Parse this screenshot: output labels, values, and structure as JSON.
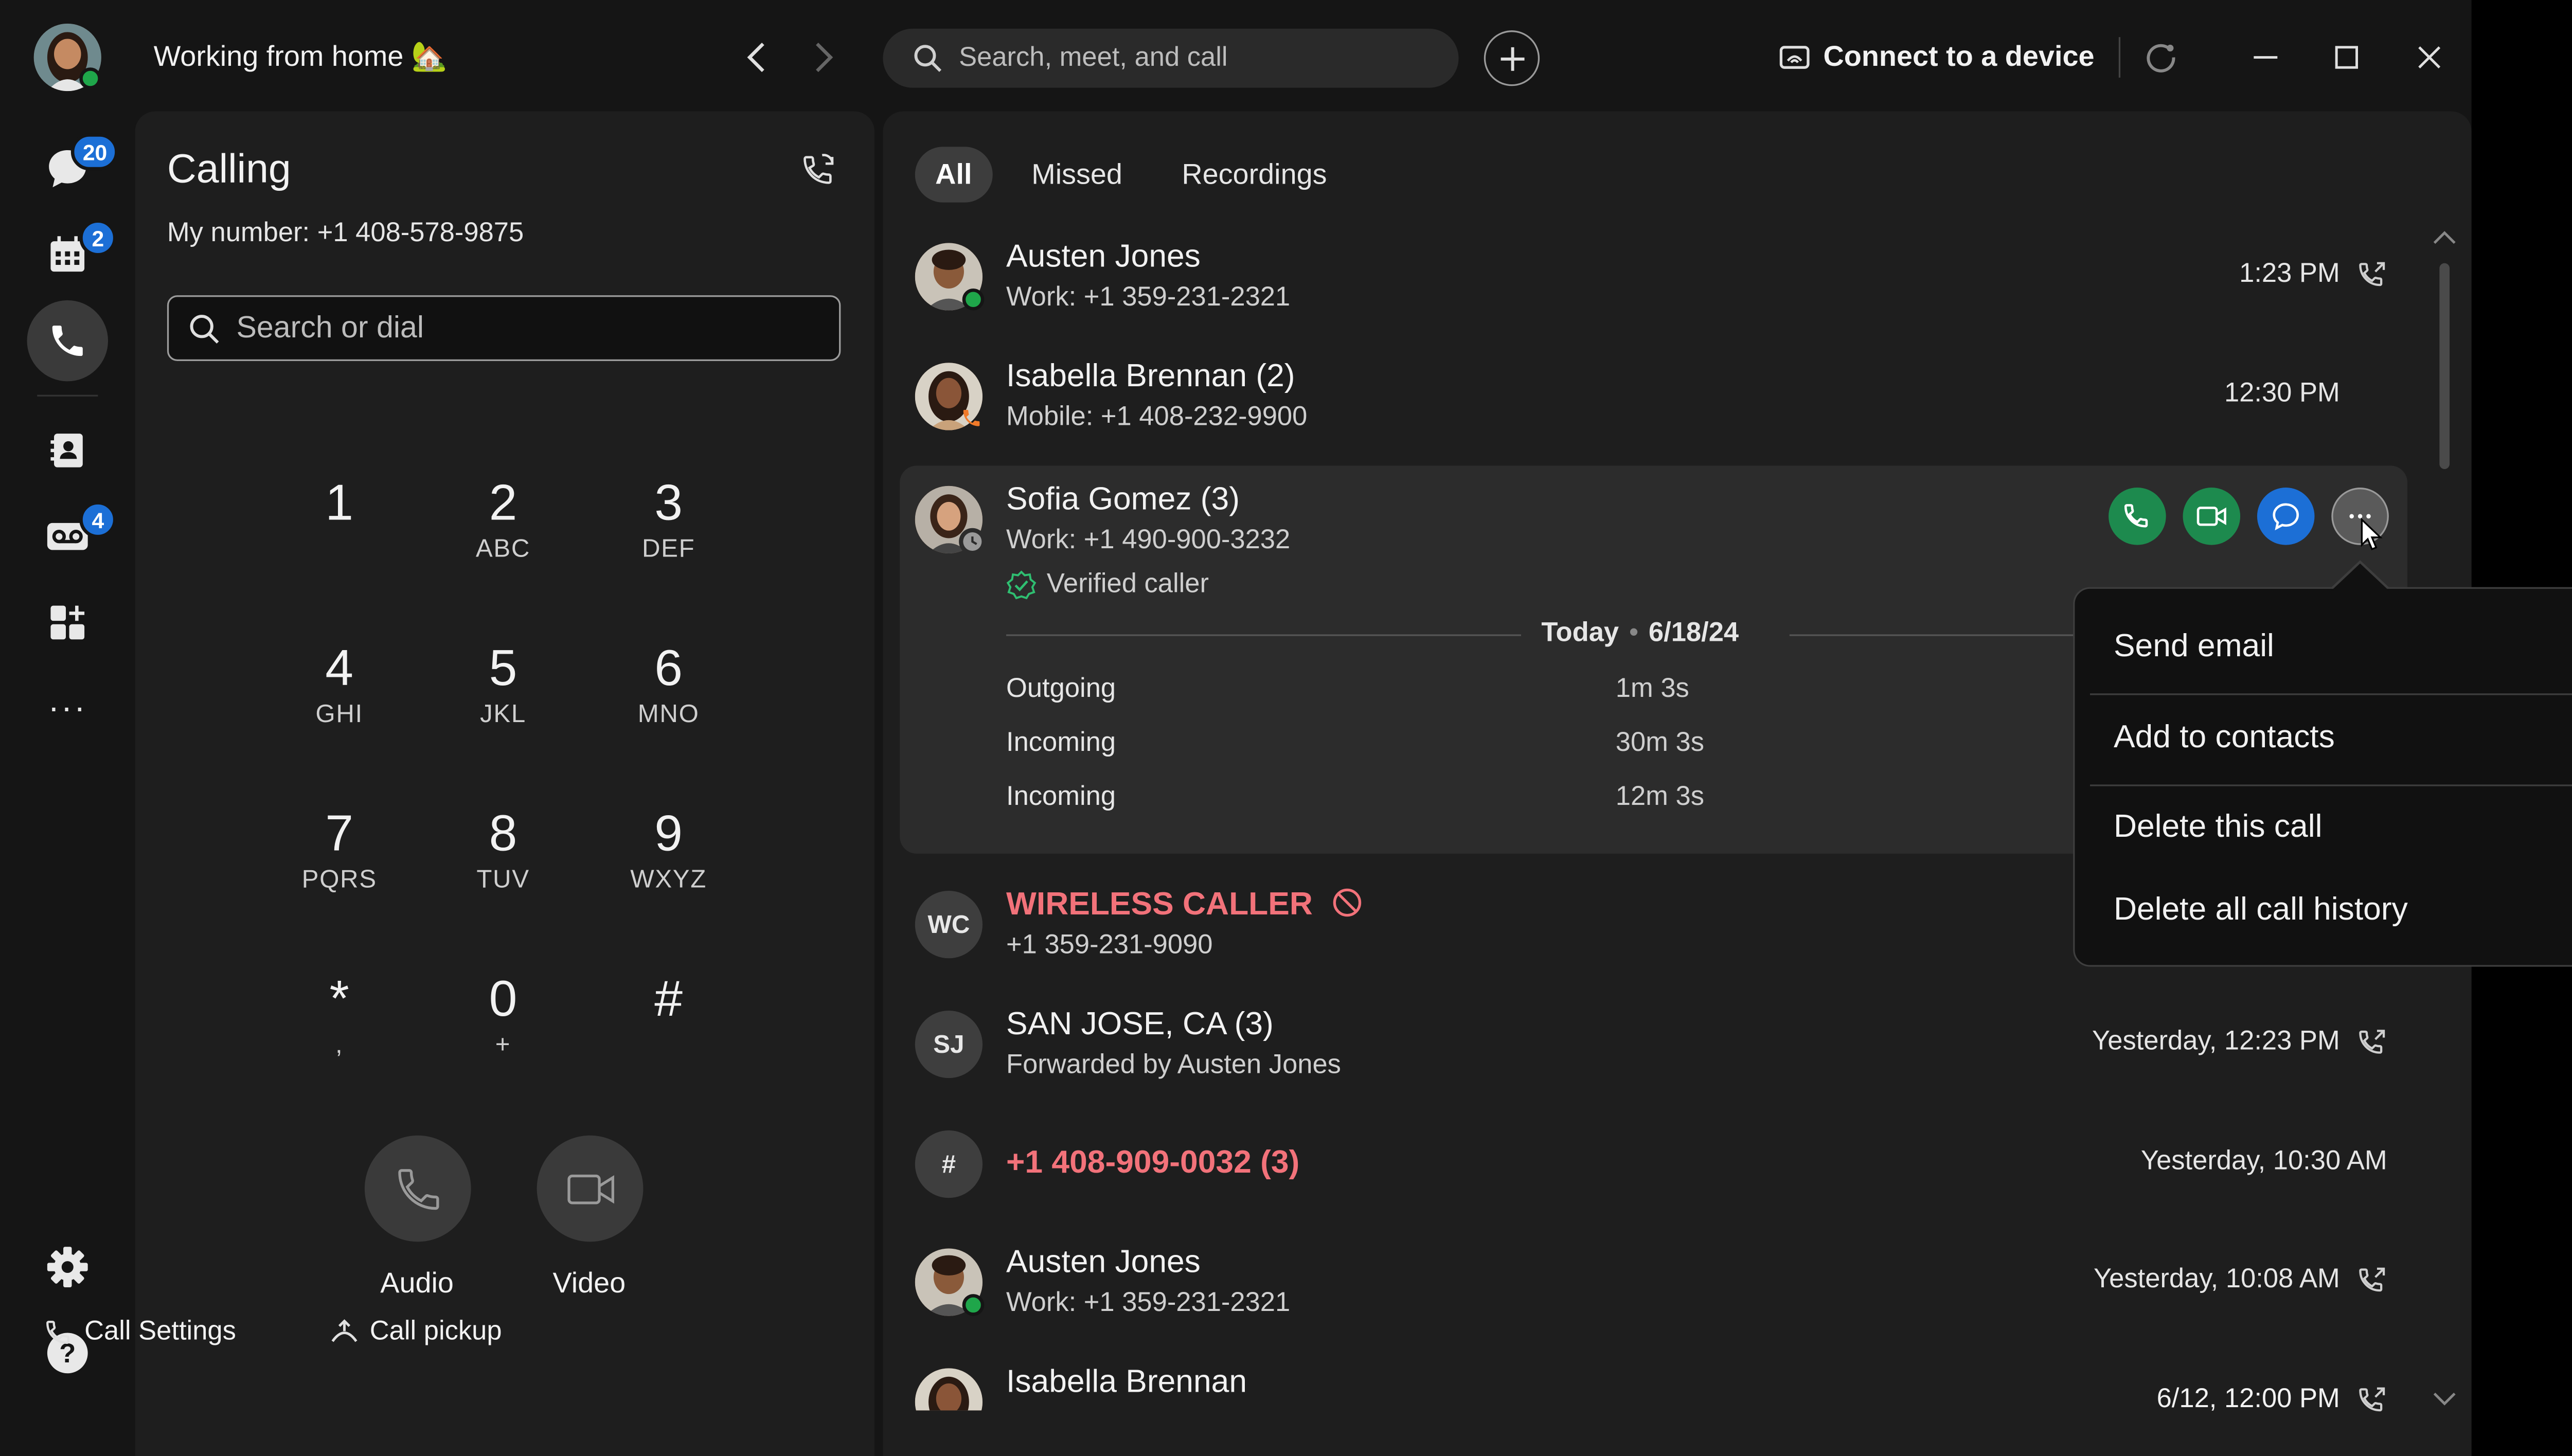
{
  "titlebar": {
    "status": "Working from home 🏡",
    "search_placeholder": "Search, meet, and call",
    "connect_label": "Connect to a device"
  },
  "rail": {
    "items": [
      {
        "name": "messaging",
        "badge": "20"
      },
      {
        "name": "meetings",
        "badge": "2"
      },
      {
        "name": "calling",
        "badge": ""
      },
      {
        "name": "contacts",
        "badge": ""
      },
      {
        "name": "voicemail",
        "badge": "4"
      },
      {
        "name": "apps",
        "badge": ""
      },
      {
        "name": "more",
        "badge": ""
      }
    ],
    "more_label": "···"
  },
  "calling": {
    "title": "Calling",
    "my_number": "My number: +1 408-578-9875",
    "search_placeholder": "Search or dial",
    "keys": [
      {
        "d": "1",
        "l": ""
      },
      {
        "d": "2",
        "l": "ABC"
      },
      {
        "d": "3",
        "l": "DEF"
      },
      {
        "d": "4",
        "l": "GHI"
      },
      {
        "d": "5",
        "l": "JKL"
      },
      {
        "d": "6",
        "l": "MNO"
      },
      {
        "d": "7",
        "l": "PQRS"
      },
      {
        "d": "8",
        "l": "TUV"
      },
      {
        "d": "9",
        "l": "WXYZ"
      },
      {
        "d": "*",
        "l": ","
      },
      {
        "d": "0",
        "l": "+"
      },
      {
        "d": "#",
        "l": ""
      }
    ],
    "audio_label": "Audio",
    "video_label": "Video",
    "footer": {
      "call_settings": "Call Settings",
      "call_pickup": "Call pickup"
    }
  },
  "history": {
    "tabs": [
      "All",
      "Missed",
      "Recordings"
    ],
    "rows": [
      {
        "name": "Austen Jones",
        "sub": "Work: +1 359-231-2321",
        "time": "1:23 PM"
      },
      {
        "name": "Isabella Brennan (2)",
        "sub": "Mobile: +1 408-232-9900",
        "time": "12:30 PM"
      },
      {
        "name": "Sofia Gomez (3)",
        "sub": "Work: +1 490-900-3232",
        "verified": "Verified caller"
      },
      {
        "name": "WIRELESS CALLER",
        "sub": "+1 359-231-9090",
        "initials": "WC"
      },
      {
        "name": "SAN JOSE, CA (3)",
        "sub": "Forwarded by Austen Jones",
        "time": "Yesterday, 12:23 PM",
        "initials": "SJ"
      },
      {
        "name": "+1 408-909-0032 (3)",
        "time": "Yesterday, 10:30 AM",
        "initials": "#"
      },
      {
        "name": "Austen Jones",
        "sub": "Work: +1 359-231-2321",
        "time": "Yesterday, 10:08 AM"
      },
      {
        "name": "Isabella Brennan",
        "time": "6/12, 12:00 PM"
      }
    ],
    "expanded": {
      "date_today": "Today",
      "date": "6/18/24",
      "calls": [
        {
          "type": "Outgoing",
          "duration": "1m 3s"
        },
        {
          "type": "Incoming",
          "duration": "30m 3s"
        },
        {
          "type": "Incoming",
          "duration": "12m 3s"
        }
      ]
    }
  },
  "menu": {
    "items": [
      "Send email",
      "Add to contacts",
      "Delete this call",
      "Delete all call history"
    ]
  },
  "colors": {
    "accent_blue": "#1c6fd6",
    "green": "#1d8a4e",
    "missed_red": "#f2727a",
    "presence": "#1fa64a"
  }
}
